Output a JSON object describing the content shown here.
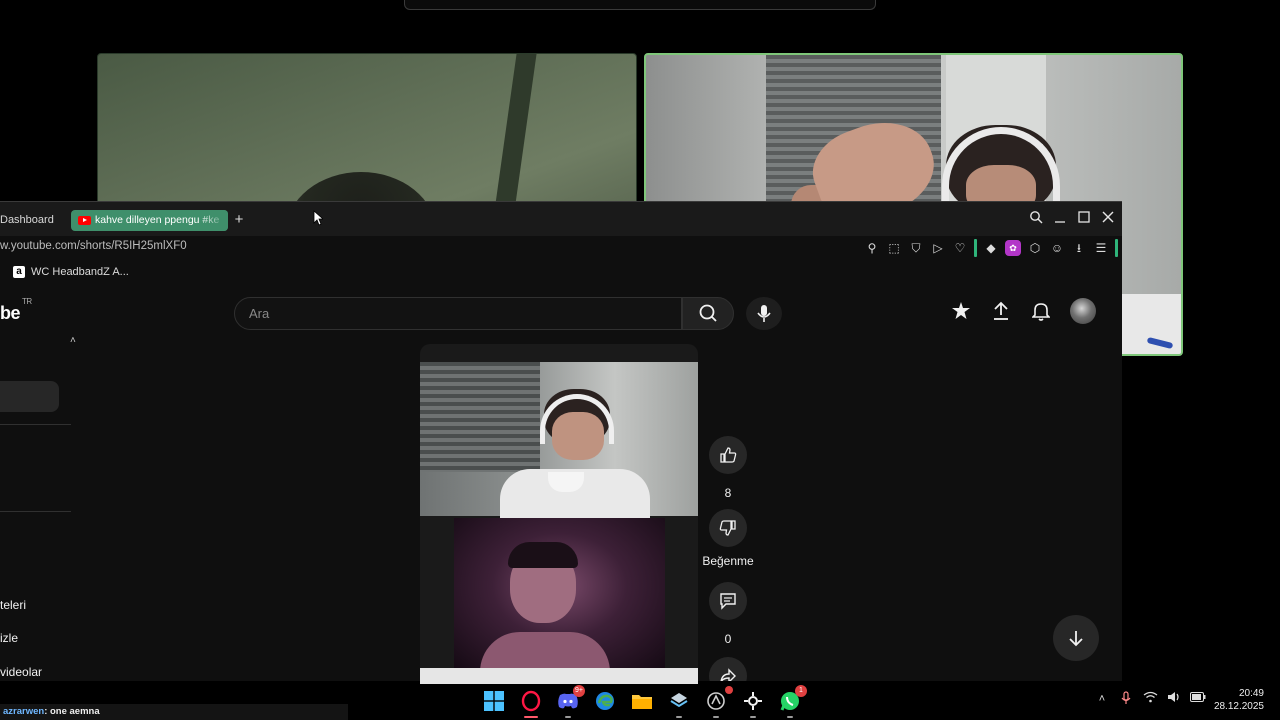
{
  "browser": {
    "tabs": [
      {
        "label": "Dashboard",
        "active": false
      },
      {
        "label": "kahve dilleyen ppengu #ke",
        "active": true
      }
    ],
    "new_tab": "+",
    "url": "w.youtube.com/shorts/R5IH25mlXF0",
    "bookmark": "WC HeadbandZ A..."
  },
  "youtube": {
    "logo": "be",
    "region": "TR",
    "search_placeholder": "Ara",
    "sidebar_items": [
      "teleri",
      "izle",
      "videolar"
    ],
    "likes": "8",
    "dislike_label": "Beğenme",
    "comments": "0"
  },
  "status": {
    "user": "azrarwen",
    "message": ": one aemna"
  },
  "taskbar": {
    "discord_badge": "9+",
    "whatsapp_badge": "1",
    "time": "20:49",
    "date": "28.12.2025"
  },
  "colors": {
    "tab_active": "#3f8f6b",
    "speaking_border": "#7fc77a",
    "yt_red": "#ff0000"
  }
}
